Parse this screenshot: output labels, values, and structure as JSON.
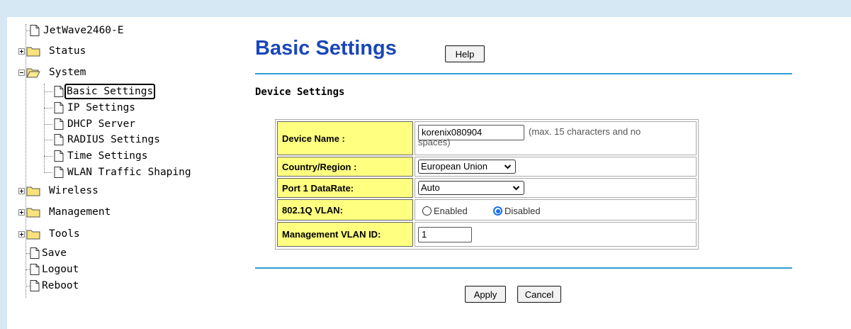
{
  "sidebar": {
    "root": "JetWave2460-E",
    "status": "Status",
    "system": "System",
    "system_items": [
      "Basic Settings",
      "IP Settings",
      "DHCP Server",
      "RADIUS Settings",
      "Time Settings",
      "WLAN Traffic Shaping"
    ],
    "wireless": "Wireless",
    "management": "Management",
    "tools": "Tools",
    "save": "Save",
    "logout": "Logout",
    "reboot": "Reboot"
  },
  "main": {
    "title": "Basic Settings",
    "help_label": "Help",
    "section_title": "Device Settings",
    "device_name": {
      "label": "Device Name :",
      "value": "korenix080904",
      "hint": "(max. 15 characters and no spaces)"
    },
    "country": {
      "label": "Country/Region :",
      "value": "European Union"
    },
    "port_rate": {
      "label": "Port 1 DataRate:",
      "value": "Auto"
    },
    "vlan": {
      "label": "802.1Q VLAN:",
      "enabled_label": "Enabled",
      "disabled_label": "Disabled",
      "selected": "Disabled"
    },
    "mgmt_vlan": {
      "label": "Management VLAN ID:",
      "value": "1"
    },
    "apply_label": "Apply",
    "cancel_label": "Cancel"
  },
  "colors": {
    "title": "#1a47b8",
    "label_cell_bg": "#ffff80",
    "divider": "#2e9fd6",
    "page_bg": "#d6e8f4"
  }
}
